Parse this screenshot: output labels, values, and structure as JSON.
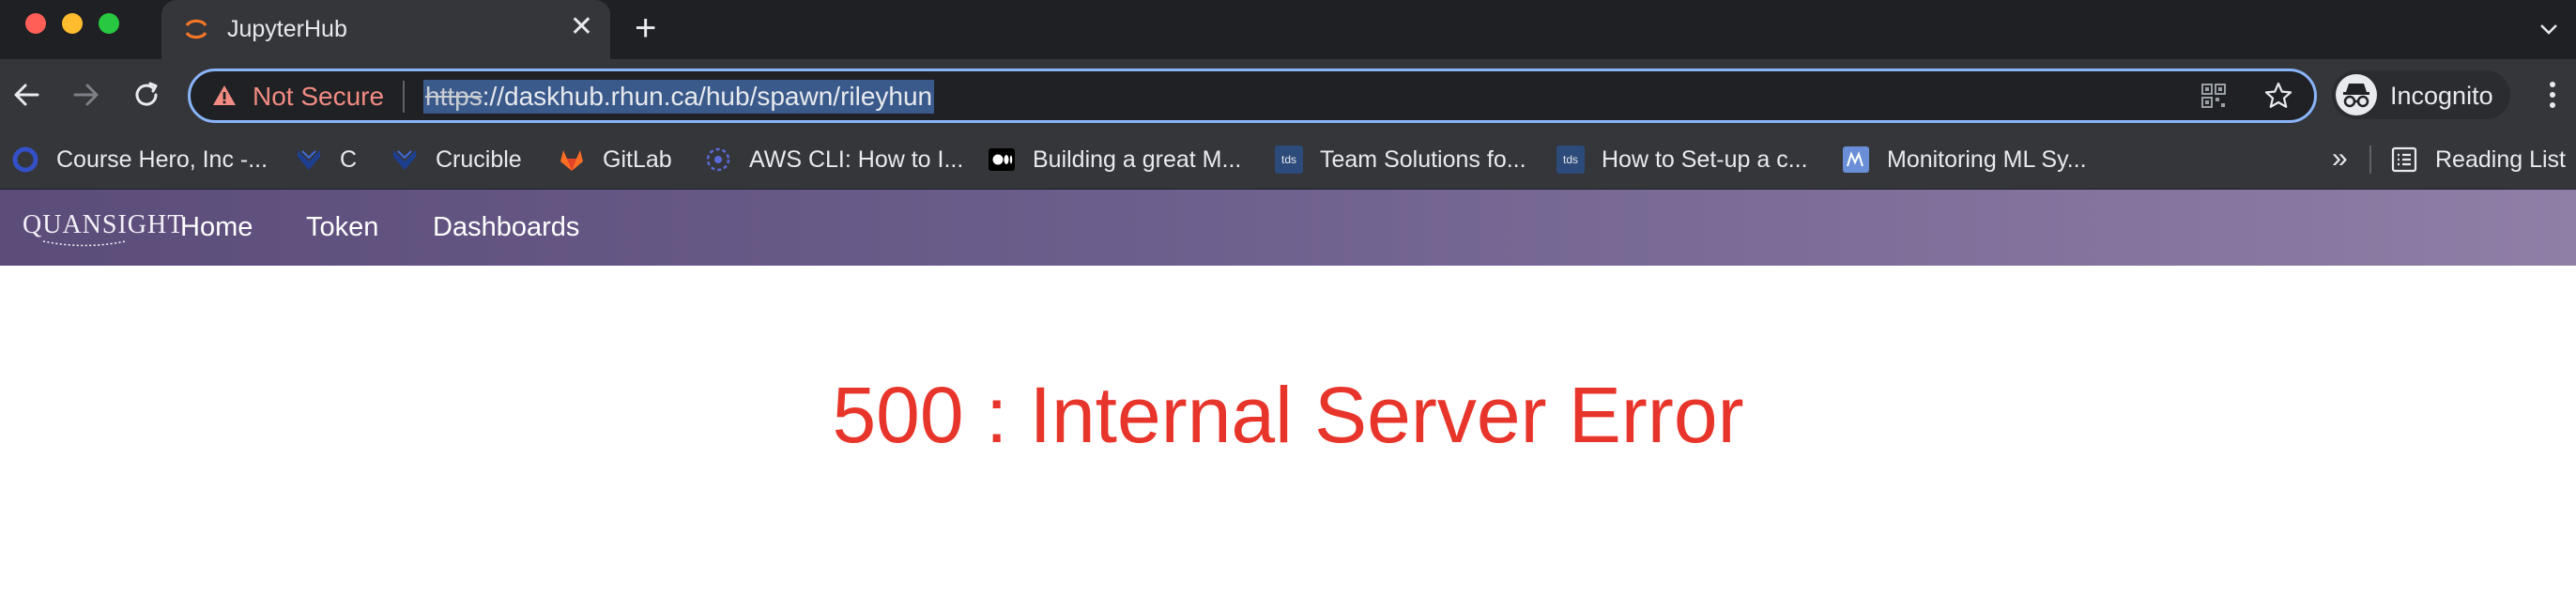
{
  "browser": {
    "tab": {
      "title": "JupyterHub",
      "close_glyph": "✕"
    },
    "new_tab_glyph": "+",
    "omnibox": {
      "security_label": "Not Secure",
      "url_scheme": "https",
      "url_rest": "://daskhub.rhun.ca/hub/spawn/rileyhun"
    },
    "profile_label": "Incognito",
    "bookmarks": [
      {
        "label": "Course Hero, Inc -...",
        "icon": "coursehero-icon"
      },
      {
        "label": "C",
        "icon": "crucible-icon"
      },
      {
        "label": "Crucible",
        "icon": "crucible-icon"
      },
      {
        "label": "GitLab",
        "icon": "gitlab-icon"
      },
      {
        "label": "AWS CLI: How to I...",
        "icon": "aws-icon"
      },
      {
        "label": "Building a great M...",
        "icon": "medium-icon"
      },
      {
        "label": "Team Solutions fo...",
        "icon": "tds-icon"
      },
      {
        "label": "How to Set-up a c...",
        "icon": "tds-icon"
      },
      {
        "label": "Monitoring ML Sy...",
        "icon": "ml-icon"
      }
    ],
    "bookmarks_overflow": "»",
    "reading_list_label": "Reading List",
    "tds_icon_text": "tds"
  },
  "page": {
    "logo_text": "QUANSIGHT",
    "nav": {
      "home": "Home",
      "token": "Token",
      "dashboards": "Dashboards"
    },
    "error_title": "500 : Internal Server Error"
  },
  "colors": {
    "error_red": "#e8352b",
    "navbar_start": "#5b4c79",
    "navbar_end": "#8f7ea6",
    "omnibox_focus": "#8ab4f8",
    "not_secure": "#f28b82"
  }
}
